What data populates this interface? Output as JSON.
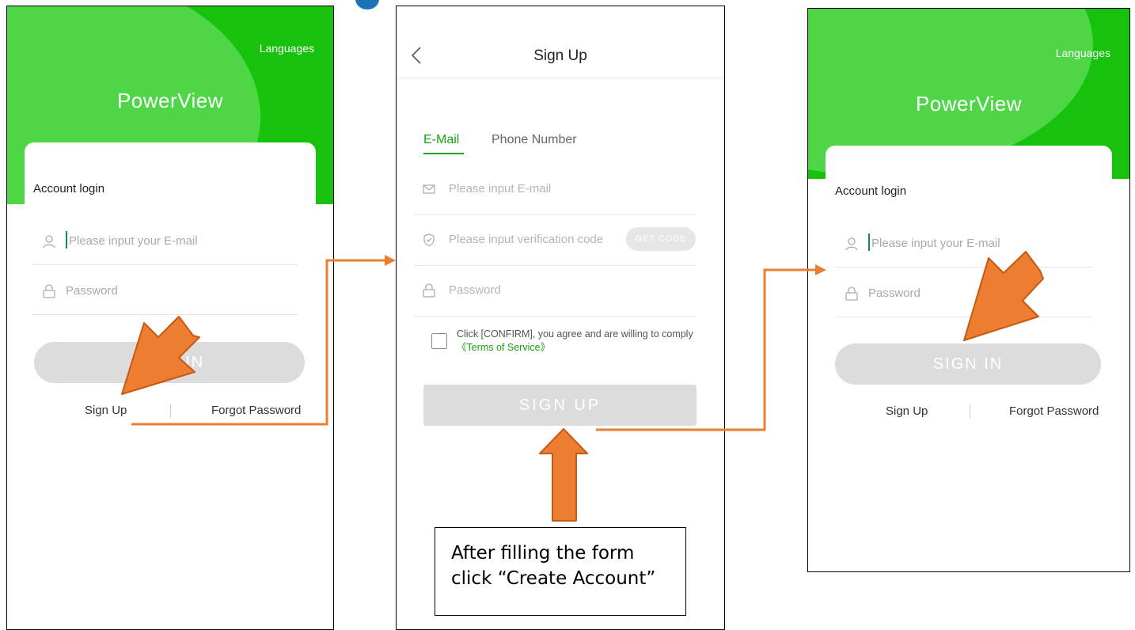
{
  "login_screen": {
    "languages": "Languages",
    "brand": "PowerView",
    "account_login": "Account login",
    "email_placeholder": "Please input your E-mail",
    "password_placeholder": "Password",
    "sign_in": "SIGN IN",
    "sign_up_link": "Sign Up",
    "forgot_password": "Forgot Password"
  },
  "signup_screen": {
    "title": "Sign Up",
    "tabs": [
      "E-Mail",
      "Phone Number"
    ],
    "email_placeholder": "Please input E-mail",
    "code_placeholder": "Please input verification code",
    "get_code": "GET CODE",
    "password_placeholder": "Password",
    "terms_prefix": "Click [CONFIRM], you agree and are willing to comply",
    "terms_link": "《Terms of Service》",
    "sign_up_button": "SIGN UP"
  },
  "callout": {
    "text": "After filling the form click “Create Account”"
  },
  "colors": {
    "brand_green": "#17c20c",
    "accent_green": "#17a30e",
    "arrow_orange": "#ed7d31",
    "disabled_button": "#dcdcdc"
  }
}
